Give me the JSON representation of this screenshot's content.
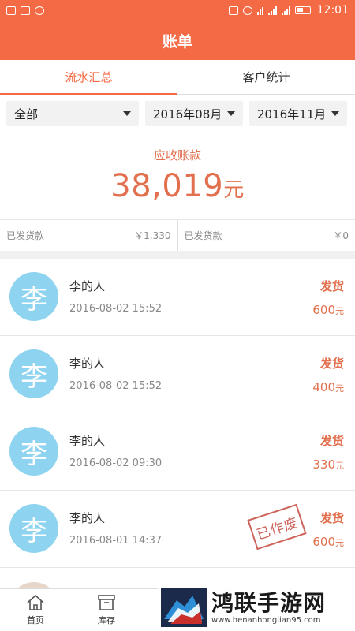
{
  "status_bar": {
    "time": "12:01"
  },
  "header": {
    "title": "账单"
  },
  "tabs": [
    {
      "label": "流水汇总",
      "active": true
    },
    {
      "label": "客户统计",
      "active": false
    }
  ],
  "filters": {
    "category": "全部",
    "start_month": "2016年08月",
    "end_month": "2016年11月"
  },
  "receivable": {
    "label": "应收账款",
    "amount": "38,019",
    "unit": "元"
  },
  "shipped": [
    {
      "label": "已发货款",
      "value": "￥1,330"
    },
    {
      "label": "已发货款",
      "value": "￥0"
    }
  ],
  "records": [
    {
      "avatar": "李",
      "name": "李的人",
      "time": "2016-08-02 15:52",
      "status": "发货",
      "amount": "600",
      "unit": "元"
    },
    {
      "avatar": "李",
      "name": "李的人",
      "time": "2016-08-02 15:52",
      "status": "发货",
      "amount": "400",
      "unit": "元"
    },
    {
      "avatar": "李",
      "name": "李的人",
      "time": "2016-08-02 09:30",
      "status": "发货",
      "amount": "330",
      "unit": "元"
    },
    {
      "avatar": "李",
      "name": "李的人",
      "time": "2016-08-01 14:37",
      "status": "发货",
      "amount": "600",
      "unit": "元",
      "stamp": "已作废"
    }
  ],
  "bottom_nav": [
    {
      "label": "首页",
      "icon": "home-icon"
    },
    {
      "label": "库存",
      "icon": "inventory-icon"
    }
  ],
  "watermark": {
    "title": "鸿联手游网",
    "url": "www.henanhonglian95.com"
  },
  "colors": {
    "accent": "#f36a44",
    "amount": "#e2704f",
    "avatar": "#8ed3ef",
    "stamp": "#c5483e"
  }
}
